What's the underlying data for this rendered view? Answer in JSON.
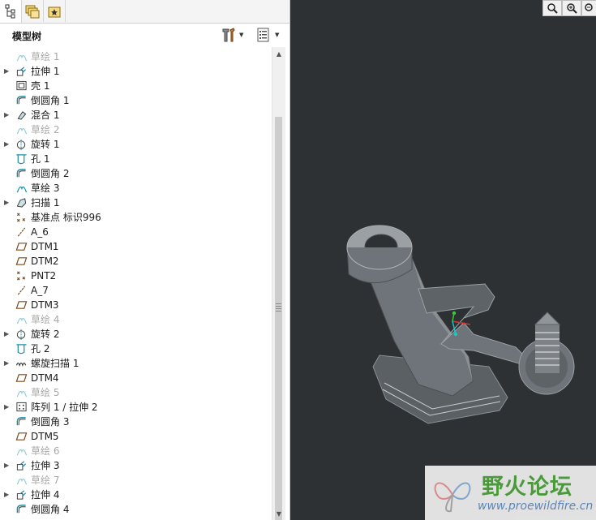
{
  "panel": {
    "title": "模型树"
  },
  "tree_items": [
    {
      "label": "草绘 1",
      "icon": "sketch-icon",
      "dim": true,
      "expandable": false
    },
    {
      "label": "拉伸 1",
      "icon": "extrude-icon",
      "dim": false,
      "expandable": true
    },
    {
      "label": "壳 1",
      "icon": "shell-icon",
      "dim": false,
      "expandable": false
    },
    {
      "label": "倒圆角 1",
      "icon": "round-icon",
      "dim": false,
      "expandable": false
    },
    {
      "label": "混合 1",
      "icon": "blend-icon",
      "dim": false,
      "expandable": true
    },
    {
      "label": "草绘 2",
      "icon": "sketch-icon",
      "dim": true,
      "expandable": false
    },
    {
      "label": "旋转 1",
      "icon": "revolve-icon",
      "dim": false,
      "expandable": true
    },
    {
      "label": "孔 1",
      "icon": "hole-icon",
      "dim": false,
      "expandable": false
    },
    {
      "label": "倒圆角 2",
      "icon": "round-icon",
      "dim": false,
      "expandable": false
    },
    {
      "label": "草绘 3",
      "icon": "sketch-icon",
      "dim": false,
      "expandable": false
    },
    {
      "label": "扫描 1",
      "icon": "sweep-icon",
      "dim": false,
      "expandable": true
    },
    {
      "label": "基准点 标识996",
      "icon": "datum-point-icon",
      "dim": false,
      "expandable": false
    },
    {
      "label": "A_6",
      "icon": "axis-icon",
      "dim": false,
      "expandable": false
    },
    {
      "label": "DTM1",
      "icon": "datum-plane-icon",
      "dim": false,
      "expandable": false
    },
    {
      "label": "DTM2",
      "icon": "datum-plane-icon",
      "dim": false,
      "expandable": false
    },
    {
      "label": "PNT2",
      "icon": "datum-point-icon",
      "dim": false,
      "expandable": false
    },
    {
      "label": "A_7",
      "icon": "axis-icon",
      "dim": false,
      "expandable": false
    },
    {
      "label": "DTM3",
      "icon": "datum-plane-icon",
      "dim": false,
      "expandable": false
    },
    {
      "label": "草绘 4",
      "icon": "sketch-icon",
      "dim": true,
      "expandable": false
    },
    {
      "label": "旋转 2",
      "icon": "revolve-icon",
      "dim": false,
      "expandable": true
    },
    {
      "label": "孔 2",
      "icon": "hole-icon",
      "dim": false,
      "expandable": false
    },
    {
      "label": "螺旋扫描 1",
      "icon": "helical-sweep-icon",
      "dim": false,
      "expandable": true
    },
    {
      "label": "DTM4",
      "icon": "datum-plane-icon",
      "dim": false,
      "expandable": false
    },
    {
      "label": "草绘 5",
      "icon": "sketch-icon",
      "dim": true,
      "expandable": false
    },
    {
      "label": "阵列 1 / 拉伸 2",
      "icon": "pattern-icon",
      "dim": false,
      "expandable": true
    },
    {
      "label": "倒圆角 3",
      "icon": "round-icon",
      "dim": false,
      "expandable": false
    },
    {
      "label": "DTM5",
      "icon": "datum-plane-icon",
      "dim": false,
      "expandable": false
    },
    {
      "label": "草绘 6",
      "icon": "sketch-icon",
      "dim": true,
      "expandable": false
    },
    {
      "label": "拉伸 3",
      "icon": "extrude-icon",
      "dim": false,
      "expandable": true
    },
    {
      "label": "草绘 7",
      "icon": "sketch-icon",
      "dim": true,
      "expandable": false
    },
    {
      "label": "拉伸 4",
      "icon": "extrude-icon",
      "dim": false,
      "expandable": true
    },
    {
      "label": "倒圆角 4",
      "icon": "round-icon",
      "dim": false,
      "expandable": false
    }
  ],
  "watermark": {
    "cn": "野火论坛",
    "url": "www.proewildfire.cn"
  },
  "colors": {
    "viewport_bg": "#2d3133",
    "model_gray": "#6e7479",
    "model_light": "#9aa0a4",
    "model_dark": "#4a4f53",
    "icon_teal": "#1c8fa6",
    "icon_brown": "#7a4a1e",
    "watermark_green": "#4a9a3a",
    "watermark_blue": "#5a86b8"
  }
}
